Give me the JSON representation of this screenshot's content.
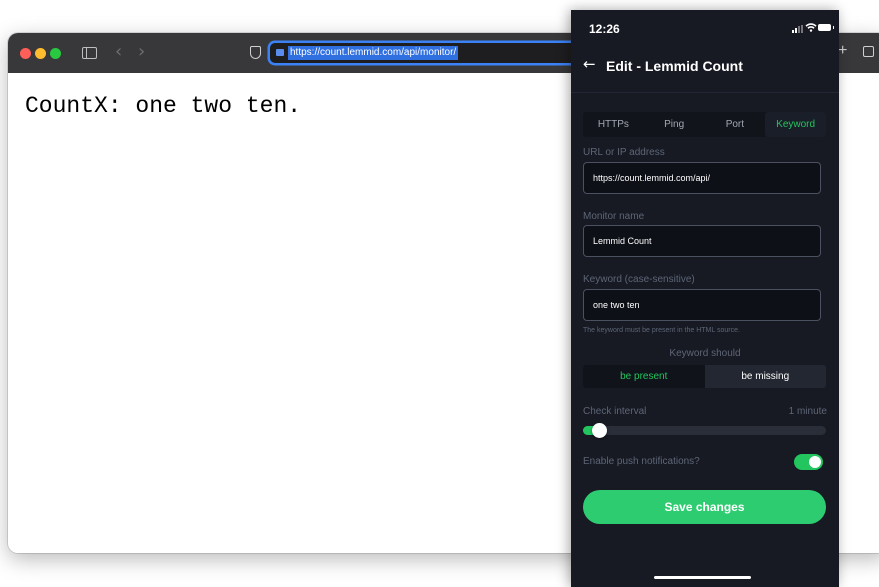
{
  "browser": {
    "url": "https://count.lemmid.com/api/monitor/",
    "page_text": "CountX: one two ten."
  },
  "phone": {
    "status_time": "12:26",
    "title": "Edit - Lemmid Count",
    "tabs": [
      {
        "label": "HTTPs",
        "active": false
      },
      {
        "label": "Ping",
        "active": false
      },
      {
        "label": "Port",
        "active": false
      },
      {
        "label": "Keyword",
        "active": true
      }
    ],
    "url_label": "URL or IP address",
    "url_value": "https://count.lemmid.com/api/",
    "monitor_name_label": "Monitor name",
    "monitor_name_value": "Lemmid Count",
    "keyword_label": "Keyword (case-sensitive)",
    "keyword_value": "one two ten",
    "keyword_helper": "The keyword must be present in the HTML source.",
    "keyword_should_label": "Keyword should",
    "keyword_should_options": [
      "be present",
      "be missing"
    ],
    "keyword_should_selected": "be present",
    "check_interval_label": "Check interval",
    "check_interval_value": "1 minute",
    "check_interval_level": 0.02,
    "push_label": "Enable push notifications?",
    "push_enabled": true,
    "save_label": "Save changes"
  },
  "colors": {
    "accent": "#22c55e",
    "phone_bg": "#171a23",
    "url_highlight": "#2f6fe0",
    "traffic_close": "#ff5f57",
    "traffic_minimize": "#febc2e",
    "traffic_maximize": "#28c840"
  },
  "icons": {
    "sidebar": "sidebar-icon",
    "back": "chevron-left-icon",
    "forward": "chevron-right-icon",
    "privacy": "shield-icon",
    "new_tab": "plus-icon",
    "tabs_overview": "tabs-icon",
    "nav_back": "arrow-left-icon",
    "signal": "signal-icon",
    "wifi": "wifi-icon",
    "battery": "battery-icon"
  }
}
